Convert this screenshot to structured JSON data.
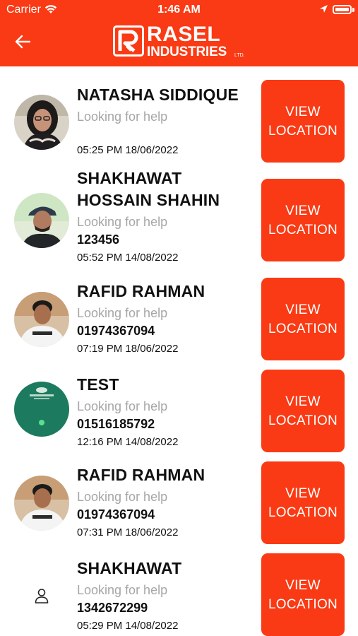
{
  "status_bar": {
    "carrier": "Carrier",
    "time": "1:46 AM",
    "icons": [
      "wifi-icon",
      "location-arrow-icon",
      "battery-icon"
    ]
  },
  "header": {
    "back_icon": "arrow-left-icon",
    "logo": {
      "name": "RASEL",
      "sub": "INDUSTRIES",
      "ltd": "LTD."
    }
  },
  "colors": {
    "accent": "#fa3a14",
    "muted_text": "#a6a6a6",
    "text": "#111111"
  },
  "requests": [
    {
      "name": "NATASHA SIDDIQUE",
      "status": "Looking for help",
      "phone": "",
      "datetime": "05:25 PM 18/06/2022",
      "button": "VIEW LOCATION",
      "avatar": "photo-woman"
    },
    {
      "name": "SHAKHAWAT HOSSAIN SHAHIN",
      "status": "Looking for help",
      "phone": "123456",
      "datetime": "05:52 PM 14/08/2022",
      "button": "VIEW LOCATION",
      "avatar": "photo-man-cap"
    },
    {
      "name": "RAFID RAHMAN",
      "status": "Looking for help",
      "phone": "01974367094",
      "datetime": "07:19 PM 18/06/2022",
      "button": "VIEW LOCATION",
      "avatar": "photo-man-tshirt"
    },
    {
      "name": "TEST",
      "status": "Looking for help",
      "phone": "01516185792",
      "datetime": "12:16 PM 14/08/2022",
      "button": "VIEW LOCATION",
      "avatar": "photo-green-screen"
    },
    {
      "name": "RAFID RAHMAN",
      "status": "Looking for help",
      "phone": "01974367094",
      "datetime": "07:31 PM 18/06/2022",
      "button": "VIEW LOCATION",
      "avatar": "photo-man-tshirt"
    },
    {
      "name": "SHAKHAWAT",
      "status": "Looking for help",
      "phone": "1342672299",
      "datetime": "05:29 PM 14/08/2022",
      "button": "VIEW LOCATION",
      "avatar": "person-outline-icon"
    }
  ]
}
